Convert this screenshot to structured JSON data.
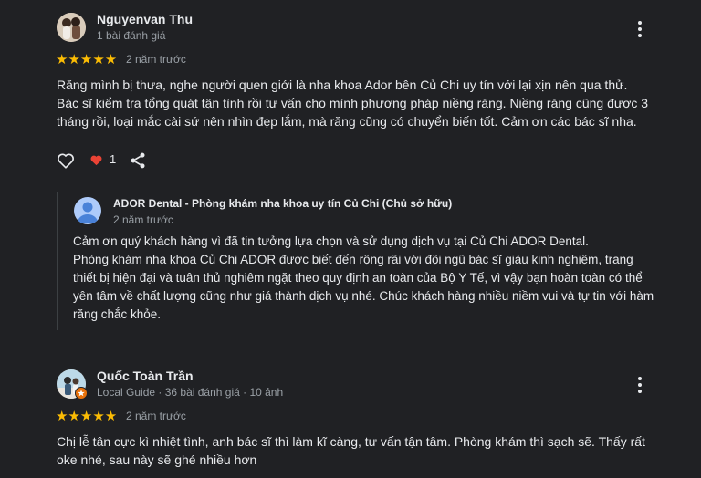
{
  "reviews": [
    {
      "author": "Nguyenvan Thu",
      "meta": "1 bài đánh giá",
      "stars": "★★★★★",
      "rating": 5,
      "time": "2 năm trước",
      "text": "Răng mình bị thưa, nghe người quen giới là nha khoa Ador bên Củ Chi uy tín với lại xịn nên qua thử. Bác sĩ kiểm tra tổng quát tận tình rồi tư vấn cho mình phương pháp niềng răng. Niềng răng cũng được 3 tháng rồi, loại mắc cài sứ nên nhìn đẹp lắm, mà răng cũng có chuyển biến tốt. Cảm ơn các bác sĩ nha.",
      "likes": "1",
      "owner_reply": {
        "name": "ADOR Dental - Phòng khám nha khoa uy tín Củ Chi (Chủ sở hữu)",
        "time": "2 năm trước",
        "text": "Cảm ơn quý khách hàng vì đã tin tưởng lựa chọn và sử dụng dịch vụ tại Củ Chi ADOR Dental.\nPhòng khám nha khoa Củ Chi ADOR được biết đến rộng rãi với đội ngũ bác sĩ giàu kinh nghiệm, trang thiết bị hiện đại và tuân thủ nghiêm ngặt theo quy định an toàn của Bộ Y Tế, vì vậy bạn hoàn toàn có thể yên tâm về chất lượng cũng như giá thành dịch vụ nhé. Chúc khách hàng nhiều niềm vui và tự tin với hàm răng chắc khỏe."
      }
    },
    {
      "author": "Quốc Toàn Trần",
      "meta": "Local Guide · 36 bài đánh giá · 10 ảnh",
      "stars": "★★★★★",
      "rating": 5,
      "time": "2 năm trước",
      "text": "Chị lễ tân cực kì nhiệt tình, anh bác sĩ thì làm kĩ càng, tư vấn tận tâm. Phòng khám thì sạch sẽ. Thấy rất oke nhé, sau này sẽ ghé nhiều hơn"
    }
  ],
  "colors": {
    "star": "#fbbc04",
    "heart": "#ea4335",
    "background": "#202124"
  },
  "icons": [
    "kebab-menu-icon",
    "heart-outline-icon",
    "heart-filled-icon",
    "share-icon",
    "person-icon",
    "local-guide-badge-icon"
  ]
}
